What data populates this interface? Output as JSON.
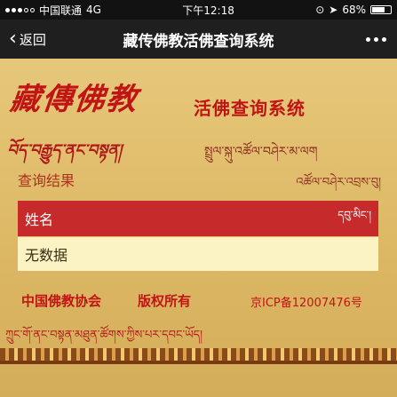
{
  "status_bar": {
    "carrier": "中国联通",
    "network": "4G",
    "time": "下午12:18",
    "battery": "68%",
    "battery_level": 0.68
  },
  "nav": {
    "back_label": "返回",
    "title": "藏传佛教活佛查询系统"
  },
  "banner": {
    "calligraphy": "藏傳佛教",
    "system_name": "活佛查询系统",
    "tibetan_script": "བོད་བརྒྱུད་ནང་བསྟན།",
    "tibetan_subtitle": "སྤྲུལ་སྐུ་འཚོལ་བཤེར་མ་ལག"
  },
  "results": {
    "label": "查询结果",
    "label_tibetan": "འཚོལ་བཤེར་འབྲས་བུ།",
    "header_name": "姓名",
    "header_name_tibetan": "དབུ་མིང་།",
    "empty_text": "无数据"
  },
  "footer": {
    "association": "中国佛教协会",
    "copyright": "版权所有",
    "icp": "京ICP备12007476号",
    "tibetan": "ཀྲུང་གོ་ནང་བསྟན་མཐུན་ཚོགས་ཀྱིས་པར་དབང་ཡོད།"
  }
}
